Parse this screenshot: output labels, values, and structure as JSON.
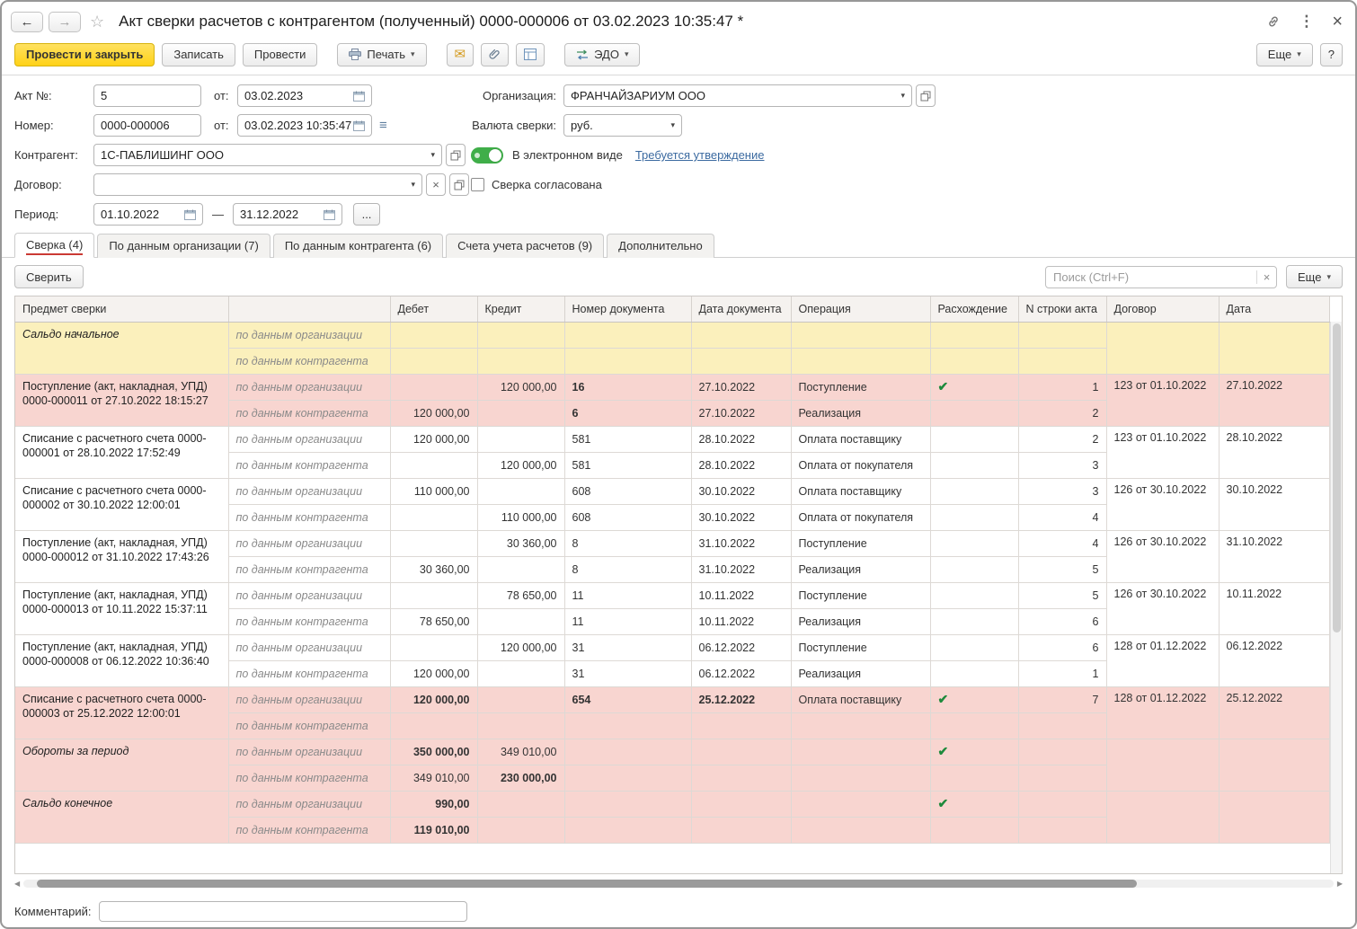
{
  "titlebar": {
    "title": "Акт сверки расчетов с контрагентом (полученный) 0000-000006 от 03.02.2023 10:35:47 *"
  },
  "toolbar": {
    "post_and_close": "Провести и закрыть",
    "write": "Записать",
    "post": "Провести",
    "print": "Печать",
    "edo": "ЭДО",
    "more": "Еще",
    "help": "?"
  },
  "form": {
    "act_no": {
      "label": "Акт №:",
      "value": "5"
    },
    "act_from": {
      "label": "от:",
      "value": "03.02.2023"
    },
    "number": {
      "label": "Номер:",
      "value": "0000-000006"
    },
    "number_from": {
      "label": "от:",
      "value": "03.02.2023 10:35:47"
    },
    "organization": {
      "label": "Организация:",
      "value": "ФРАНЧАЙЗАРИУМ ООО"
    },
    "currency": {
      "label": "Валюта сверки:",
      "value": "руб."
    },
    "counterparty": {
      "label": "Контрагент:",
      "value": "1С-ПАБЛИШИНГ ООО"
    },
    "electronic": {
      "label": "В электронном виде",
      "link": "Требуется утверждение",
      "enabled": true
    },
    "contract": {
      "label": "Договор:",
      "value": ""
    },
    "agreed": {
      "label": "Сверка согласована",
      "checked": false
    },
    "period": {
      "label": "Период:",
      "from": "01.10.2022",
      "dash": "—",
      "to": "31.12.2022"
    }
  },
  "tabs": [
    {
      "id": "sverka",
      "label": "Сверка (4)",
      "active": true
    },
    {
      "id": "org-data",
      "label": "По данным организации (7)",
      "active": false
    },
    {
      "id": "cp-data",
      "label": "По данным контрагента (6)",
      "active": false
    },
    {
      "id": "accounts",
      "label": "Счета учета расчетов (9)",
      "active": false
    },
    {
      "id": "additional",
      "label": "Дополнительно",
      "active": false
    }
  ],
  "panel_toolbar": {
    "compare": "Сверить",
    "search_placeholder": "Поиск (Ctrl+F)",
    "more": "Еще"
  },
  "table": {
    "headers": [
      "Предмет сверки",
      "",
      "Дебет",
      "Кредит",
      "Номер документа",
      "Дата документа",
      "Операция",
      "Расхождение",
      "N строки акта",
      "Договор",
      "Дата"
    ],
    "rows": [
      {
        "subject": "Сальдо начальное",
        "tone": "yellow",
        "italic": true,
        "sub": [
          {
            "label": "по данным организации"
          },
          {
            "label": "по данным контрагента"
          }
        ],
        "contract": "",
        "date": ""
      },
      {
        "subject": "Поступление (акт, накладная, УПД) 0000-000011 от 27.10.2022 18:15:27",
        "tone": "pink",
        "italic": false,
        "sub": [
          {
            "label": "по данным организации",
            "credit": "120 000,00",
            "doc_no": "16",
            "doc_date": "27.10.2022",
            "operation": "Поступление",
            "check": true,
            "line_no": "1",
            "bold": [
              "doc_no"
            ]
          },
          {
            "label": "по данным контрагента",
            "debit": "120 000,00",
            "doc_no": "6",
            "doc_date": "27.10.2022",
            "operation": "Реализация",
            "line_no": "2",
            "bold": [
              "doc_no"
            ]
          }
        ],
        "contract": "123 от 01.10.2022",
        "date": "27.10.2022"
      },
      {
        "subject": "Списание с расчетного счета 0000-000001 от 28.10.2022 17:52:49",
        "tone": "white",
        "italic": false,
        "sub": [
          {
            "label": "по данным организации",
            "debit": "120 000,00",
            "doc_no": "581",
            "doc_date": "28.10.2022",
            "operation": "Оплата поставщику",
            "line_no": "2"
          },
          {
            "label": "по данным контрагента",
            "credit": "120 000,00",
            "doc_no": "581",
            "doc_date": "28.10.2022",
            "operation": "Оплата от покупателя",
            "line_no": "3"
          }
        ],
        "contract": "123 от 01.10.2022",
        "date": "28.10.2022"
      },
      {
        "subject": "Списание с расчетного счета 0000-000002 от 30.10.2022 12:00:01",
        "tone": "white",
        "italic": false,
        "sub": [
          {
            "label": "по данным организации",
            "debit": "110 000,00",
            "doc_no": "608",
            "doc_date": "30.10.2022",
            "operation": "Оплата поставщику",
            "line_no": "3"
          },
          {
            "label": "по данным контрагента",
            "credit": "110 000,00",
            "doc_no": "608",
            "doc_date": "30.10.2022",
            "operation": "Оплата от покупателя",
            "line_no": "4"
          }
        ],
        "contract": "126 от 30.10.2022",
        "date": "30.10.2022"
      },
      {
        "subject": "Поступление (акт, накладная, УПД) 0000-000012 от 31.10.2022 17:43:26",
        "tone": "white",
        "italic": false,
        "sub": [
          {
            "label": "по данным организации",
            "credit": "30 360,00",
            "doc_no": "8",
            "doc_date": "31.10.2022",
            "operation": "Поступление",
            "line_no": "4"
          },
          {
            "label": "по данным контрагента",
            "debit": "30 360,00",
            "doc_no": "8",
            "doc_date": "31.10.2022",
            "operation": "Реализация",
            "line_no": "5"
          }
        ],
        "contract": "126 от 30.10.2022",
        "date": "31.10.2022"
      },
      {
        "subject": "Поступление (акт, накладная, УПД) 0000-000013 от 10.11.2022 15:37:11",
        "tone": "white",
        "italic": false,
        "sub": [
          {
            "label": "по данным организации",
            "credit": "78 650,00",
            "doc_no": "11",
            "doc_date": "10.11.2022",
            "operation": "Поступление",
            "line_no": "5"
          },
          {
            "label": "по данным контрагента",
            "debit": "78 650,00",
            "doc_no": "11",
            "doc_date": "10.11.2022",
            "operation": "Реализация",
            "line_no": "6"
          }
        ],
        "contract": "126 от 30.10.2022",
        "date": "10.11.2022"
      },
      {
        "subject": "Поступление (акт, накладная, УПД) 0000-000008 от 06.12.2022 10:36:40",
        "tone": "white",
        "italic": false,
        "sub": [
          {
            "label": "по данным организации",
            "credit": "120 000,00",
            "doc_no": "31",
            "doc_date": "06.12.2022",
            "operation": "Поступление",
            "line_no": "6"
          },
          {
            "label": "по данным контрагента",
            "debit": "120 000,00",
            "doc_no": "31",
            "doc_date": "06.12.2022",
            "operation": "Реализация",
            "line_no": "1"
          }
        ],
        "contract": "128 от 01.12.2022",
        "date": "06.12.2022"
      },
      {
        "subject": "Списание с расчетного счета 0000-000003 от 25.12.2022 12:00:01",
        "tone": "pink",
        "italic": false,
        "sub": [
          {
            "label": "по данным организации",
            "debit": "120 000,00",
            "doc_no": "654",
            "doc_date": "25.12.2022",
            "operation": "Оплата поставщику",
            "check": true,
            "line_no": "7",
            "bold": [
              "debit",
              "doc_no",
              "doc_date"
            ]
          },
          {
            "label": "по данным контрагента"
          }
        ],
        "contract": "128 от 01.12.2022",
        "date": "25.12.2022"
      },
      {
        "subject": "Обороты за период",
        "tone": "pink",
        "italic": true,
        "sub": [
          {
            "label": "по данным организации",
            "debit": "350 000,00",
            "credit": "349 010,00",
            "check": true,
            "bold": [
              "debit"
            ]
          },
          {
            "label": "по данным контрагента",
            "debit": "349 010,00",
            "credit": "230 000,00",
            "bold": [
              "credit"
            ]
          }
        ],
        "contract": "",
        "date": ""
      },
      {
        "subject": "Сальдо конечное",
        "tone": "pink",
        "italic": true,
        "sub": [
          {
            "label": "по данным организации",
            "debit": "990,00",
            "check": true,
            "bold": [
              "debit"
            ]
          },
          {
            "label": "по данным контрагента",
            "debit": "119 010,00",
            "bold": [
              "debit"
            ]
          }
        ],
        "contract": "",
        "date": ""
      }
    ]
  },
  "footer": {
    "comment_label": "Комментарий:",
    "comment_value": ""
  },
  "colors": {
    "accent_yellow": "#ffd217",
    "row_yellow": "#fbf0bc",
    "row_pink": "#f8d5d0",
    "check_green": "#1e8a3c",
    "link_blue": "#3b6aa0",
    "active_tab_underline": "#ca3a34"
  }
}
